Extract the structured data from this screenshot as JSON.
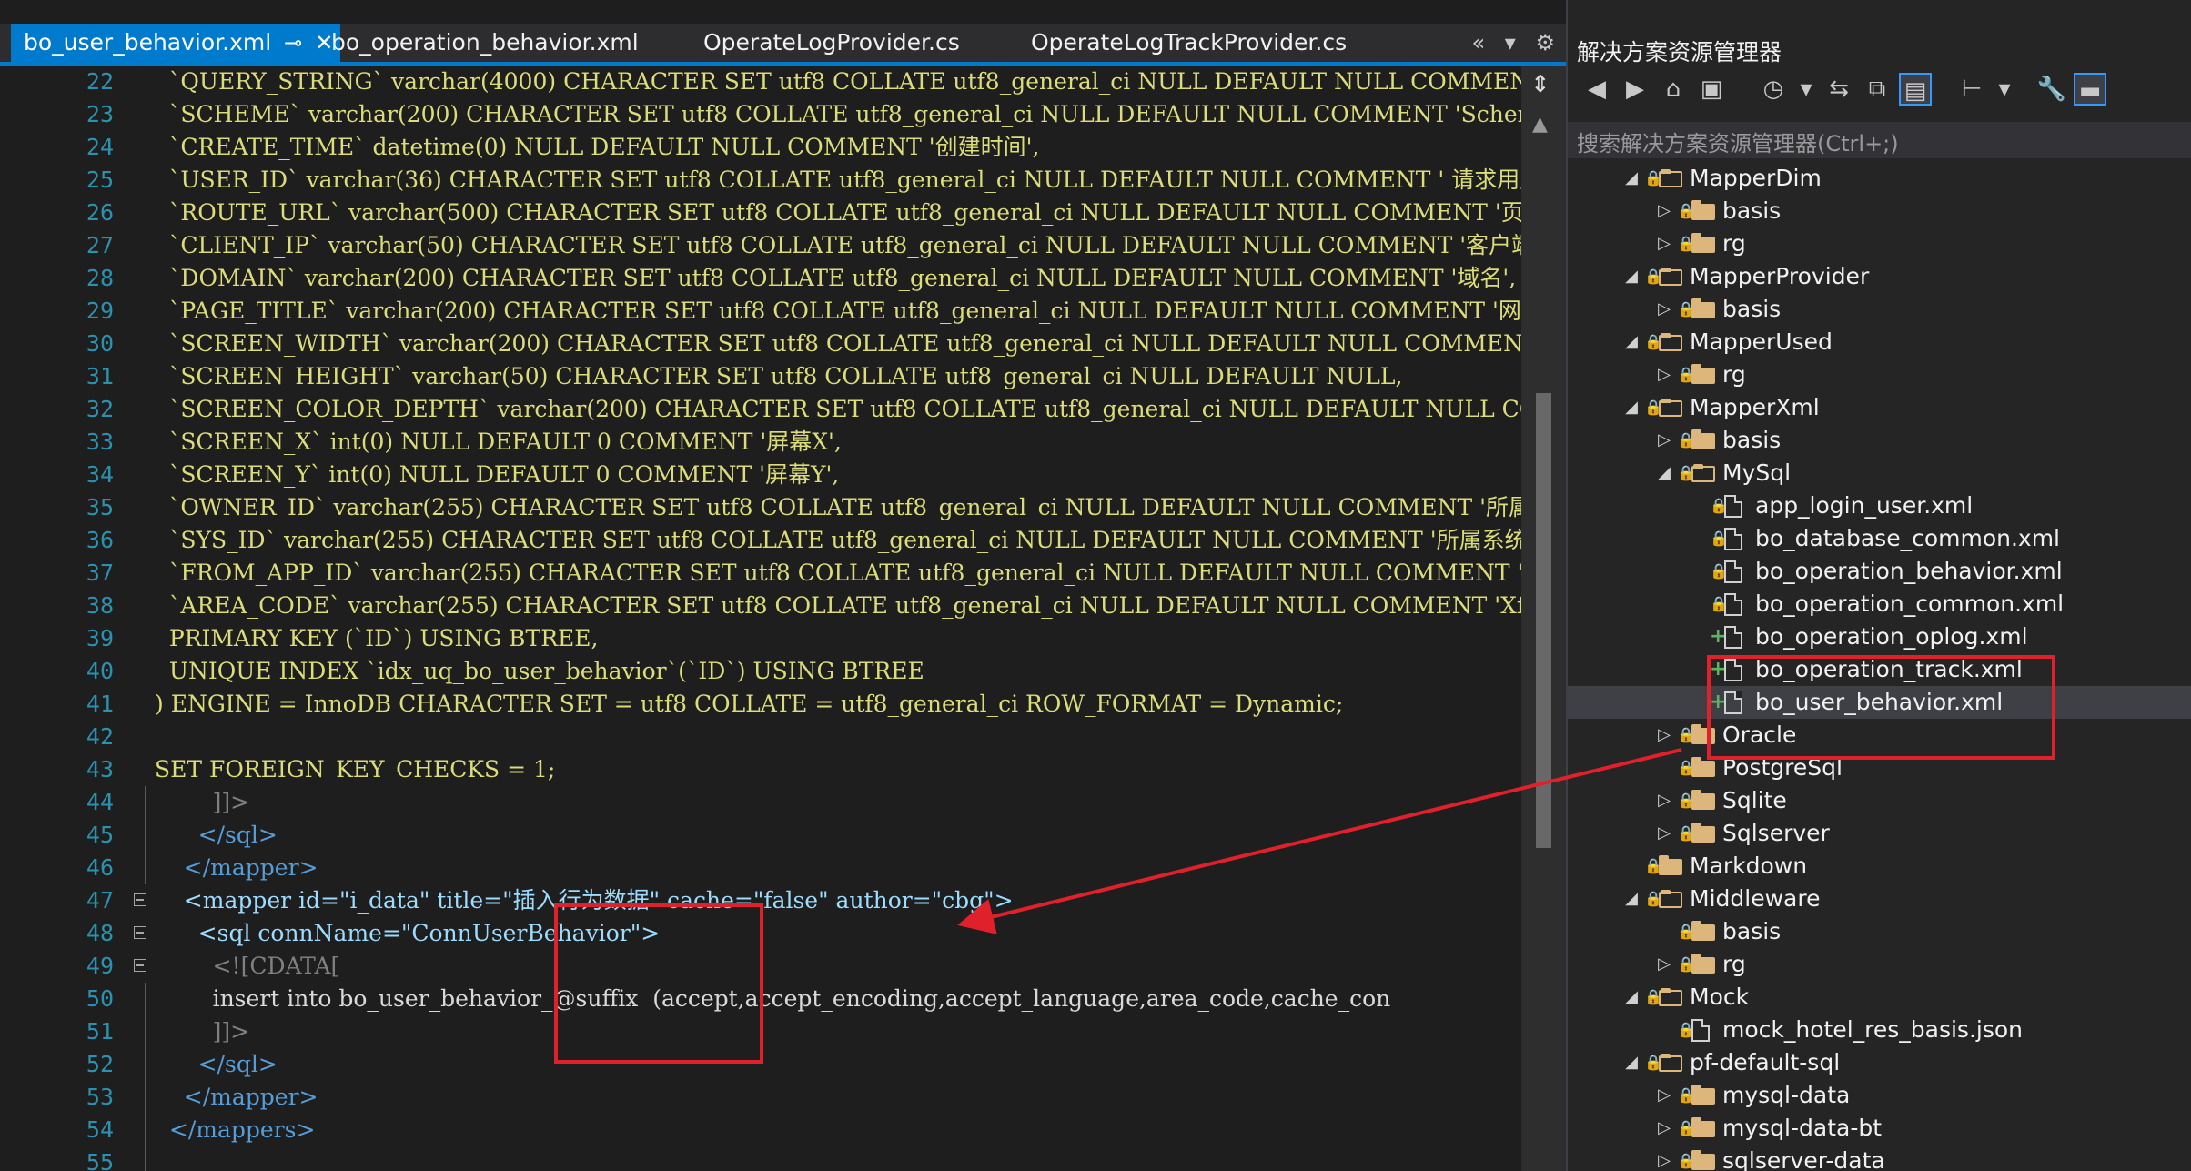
{
  "tabs": [
    {
      "label": "bo_user_behavior.xml",
      "active": true
    },
    {
      "label": "bo_operation_behavior.xml",
      "active": false
    },
    {
      "label": "OperateLogProvider.cs",
      "active": false
    },
    {
      "label": "OperateLogTrackProvider.cs",
      "active": false
    }
  ],
  "tab_tools": {
    "overflow": "«",
    "dropdown": "▾",
    "settings": "⚙"
  },
  "code_lines": [
    {
      "n": "22",
      "text": "  `QUERY_STRING` varchar(4000) CHARACTER SET utf8 COLLATE utf8_general_ci NULL DEFAULT NULL COMMENT 'ur"
    },
    {
      "n": "23",
      "text": "  `SCHEME` varchar(200) CHARACTER SET utf8 COLLATE utf8_general_ci NULL DEFAULT NULL COMMENT 'Scheme  协"
    },
    {
      "n": "24",
      "text": "  `CREATE_TIME` datetime(0) NULL DEFAULT NULL COMMENT '创建时间',"
    },
    {
      "n": "25",
      "text": "  `USER_ID` varchar(36) CHARACTER SET utf8 COLLATE utf8_general_ci NULL DEFAULT NULL COMMENT ' 请求用户"
    },
    {
      "n": "26",
      "text": "  `ROUTE_URL` varchar(500) CHARACTER SET utf8 COLLATE utf8_general_ci NULL DEFAULT NULL COMMENT '页面路"
    },
    {
      "n": "27",
      "text": "  `CLIENT_IP` varchar(50) CHARACTER SET utf8 COLLATE utf8_general_ci NULL DEFAULT NULL COMMENT '客户端I"
    },
    {
      "n": "28",
      "text": "  `DOMAIN` varchar(200) CHARACTER SET utf8 COLLATE utf8_general_ci NULL DEFAULT NULL COMMENT '域名',"
    },
    {
      "n": "29",
      "text": "  `PAGE_TITLE` varchar(200) CHARACTER SET utf8 COLLATE utf8_general_ci NULL DEFAULT NULL COMMENT '网页标"
    },
    {
      "n": "30",
      "text": "  `SCREEN_WIDTH` varchar(200) CHARACTER SET utf8 COLLATE utf8_general_ci NULL DEFAULT NULL COMMENT '分辨"
    },
    {
      "n": "31",
      "text": "  `SCREEN_HEIGHT` varchar(50) CHARACTER SET utf8 COLLATE utf8_general_ci NULL DEFAULT NULL,"
    },
    {
      "n": "32",
      "text": "  `SCREEN_COLOR_DEPTH` varchar(200) CHARACTER SET utf8 COLLATE utf8_general_ci NULL DEFAULT NULL COMMEN"
    },
    {
      "n": "33",
      "text": "  `SCREEN_X` int(0) NULL DEFAULT 0 COMMENT '屏幕X',"
    },
    {
      "n": "34",
      "text": "  `SCREEN_Y` int(0) NULL DEFAULT 0 COMMENT '屏幕Y',"
    },
    {
      "n": "35",
      "text": "  `OWNER_ID` varchar(255) CHARACTER SET utf8 COLLATE utf8_general_ci NULL DEFAULT NULL COMMENT '所属项目"
    },
    {
      "n": "36",
      "text": "  `SYS_ID` varchar(255) CHARACTER SET utf8 COLLATE utf8_general_ci NULL DEFAULT NULL COMMENT '所属系统"
    },
    {
      "n": "37",
      "text": "  `FROM_APP_ID` varchar(255) CHARACTER SET utf8 COLLATE utf8_general_ci NULL DEFAULT NULL COMMENT 'Xfro"
    },
    {
      "n": "38",
      "text": "  `AREA_CODE` varchar(255) CHARACTER SET utf8 COLLATE utf8_general_ci NULL DEFAULT NULL COMMENT 'Xfilte"
    },
    {
      "n": "39",
      "text": "  PRIMARY KEY (`ID`) USING BTREE,"
    },
    {
      "n": "40",
      "text": "  UNIQUE INDEX `idx_uq_bo_user_behavior`(`ID`) USING BTREE"
    },
    {
      "n": "41",
      "text": ") ENGINE = InnoDB CHARACTER SET = utf8 COLLATE = utf8_general_ci ROW_FORMAT = Dynamic;"
    },
    {
      "n": "42",
      "text": ""
    },
    {
      "n": "43",
      "text": "SET FOREIGN_KEY_CHECKS = 1;"
    },
    {
      "n": "44",
      "text": "        ]]>"
    },
    {
      "n": "45",
      "text": "      </sql>"
    },
    {
      "n": "46",
      "text": "    </mapper>"
    },
    {
      "n": "47",
      "text": "    <mapper id=\"i_data\" title=\"插入行为数据\" cache=\"false\" author=\"cbg\">"
    },
    {
      "n": "48",
      "text": "      <sql connName=\"ConnUserBehavior\">"
    },
    {
      "n": "49",
      "text": "        <![CDATA["
    },
    {
      "n": "50",
      "text": "        insert into bo_user_behavior_@suffix  (accept,accept_encoding,accept_language,area_code,cache_con"
    },
    {
      "n": "51",
      "text": "        ]]>"
    },
    {
      "n": "52",
      "text": "      </sql>"
    },
    {
      "n": "53",
      "text": "    </mapper>"
    },
    {
      "n": "54",
      "text": "  </mappers>"
    },
    {
      "n": "55",
      "text": ""
    }
  ],
  "solution_explorer": {
    "title": "解决方案资源管理器",
    "search_placeholder": "搜索解决方案资源管理器(Ctrl+;)",
    "toolbar_icons": [
      "back-icon",
      "forward-icon",
      "home-icon",
      "vs-switch-icon",
      "history-icon",
      "dropdown-icon",
      "sync-icon",
      "collapse-all-icon",
      "show-all-files-icon",
      "tree-view-icon",
      "dropdown-icon",
      "properties-icon",
      "preview-icon"
    ],
    "tree": [
      {
        "label": "MapperDim",
        "kind": "folder",
        "expanded": true,
        "depth": 0,
        "badge": "lock"
      },
      {
        "label": "basis",
        "kind": "folder",
        "expanded": false,
        "depth": 1,
        "badge": "lock"
      },
      {
        "label": "rg",
        "kind": "folder",
        "expanded": false,
        "depth": 1,
        "badge": "lock"
      },
      {
        "label": "MapperProvider",
        "kind": "folder",
        "expanded": true,
        "depth": 0,
        "badge": "lock"
      },
      {
        "label": "basis",
        "kind": "folder",
        "expanded": false,
        "depth": 1,
        "badge": "lock"
      },
      {
        "label": "MapperUsed",
        "kind": "folder",
        "expanded": true,
        "depth": 0,
        "badge": "lock"
      },
      {
        "label": "rg",
        "kind": "folder",
        "expanded": false,
        "depth": 1,
        "badge": "lock"
      },
      {
        "label": "MapperXml",
        "kind": "folder",
        "expanded": true,
        "depth": 0,
        "badge": "lock"
      },
      {
        "label": "basis",
        "kind": "folder",
        "expanded": false,
        "depth": 1,
        "badge": "lock"
      },
      {
        "label": "MySql",
        "kind": "folder",
        "expanded": true,
        "depth": 1,
        "badge": "lock"
      },
      {
        "label": "app_login_user.xml",
        "kind": "file",
        "depth": 2,
        "badge": "lock"
      },
      {
        "label": "bo_database_common.xml",
        "kind": "file",
        "depth": 2,
        "badge": "lock"
      },
      {
        "label": "bo_operation_behavior.xml",
        "kind": "file",
        "depth": 2,
        "badge": "lock"
      },
      {
        "label": "bo_operation_common.xml",
        "kind": "file",
        "depth": 2,
        "badge": "lock"
      },
      {
        "label": "bo_operation_oplog.xml",
        "kind": "file",
        "depth": 2,
        "badge": "plus"
      },
      {
        "label": "bo_operation_track.xml",
        "kind": "file",
        "depth": 2,
        "badge": "plus"
      },
      {
        "label": "bo_user_behavior.xml",
        "kind": "file",
        "depth": 2,
        "badge": "plus",
        "selected": true
      },
      {
        "label": "Oracle",
        "kind": "folder",
        "expanded": false,
        "depth": 1,
        "badge": "lock"
      },
      {
        "label": "PostgreSql",
        "kind": "folder",
        "expanded": null,
        "depth": 1,
        "badge": "lock"
      },
      {
        "label": "Sqlite",
        "kind": "folder",
        "expanded": false,
        "depth": 1,
        "badge": "lock"
      },
      {
        "label": "Sqlserver",
        "kind": "folder",
        "expanded": false,
        "depth": 1,
        "badge": "lock"
      },
      {
        "label": "Markdown",
        "kind": "folder",
        "expanded": null,
        "depth": 0,
        "badge": "lock"
      },
      {
        "label": "Middleware",
        "kind": "folder",
        "expanded": true,
        "depth": 0,
        "badge": "lock"
      },
      {
        "label": "basis",
        "kind": "folder",
        "expanded": null,
        "depth": 1,
        "badge": "lock"
      },
      {
        "label": "rg",
        "kind": "folder",
        "expanded": false,
        "depth": 1,
        "badge": "lock"
      },
      {
        "label": "Mock",
        "kind": "folder",
        "expanded": true,
        "depth": 0,
        "badge": "lock"
      },
      {
        "label": "mock_hotel_res_basis.json",
        "kind": "json",
        "depth": 1,
        "badge": "lock"
      },
      {
        "label": "pf-default-sql",
        "kind": "folder",
        "expanded": true,
        "depth": 0,
        "badge": "lock"
      },
      {
        "label": "mysql-data",
        "kind": "folder",
        "expanded": false,
        "depth": 1,
        "badge": "lock"
      },
      {
        "label": "mysql-data-bt",
        "kind": "folder",
        "expanded": false,
        "depth": 1,
        "badge": "lock"
      },
      {
        "label": "sqlserver-data",
        "kind": "folder",
        "expanded": false,
        "depth": 1,
        "badge": "lock"
      }
    ]
  },
  "colors": {
    "accent": "#007acc",
    "annotation": "#e0202a",
    "sql_text": "#dcdc7a",
    "line_numbers": "#2b91af"
  }
}
